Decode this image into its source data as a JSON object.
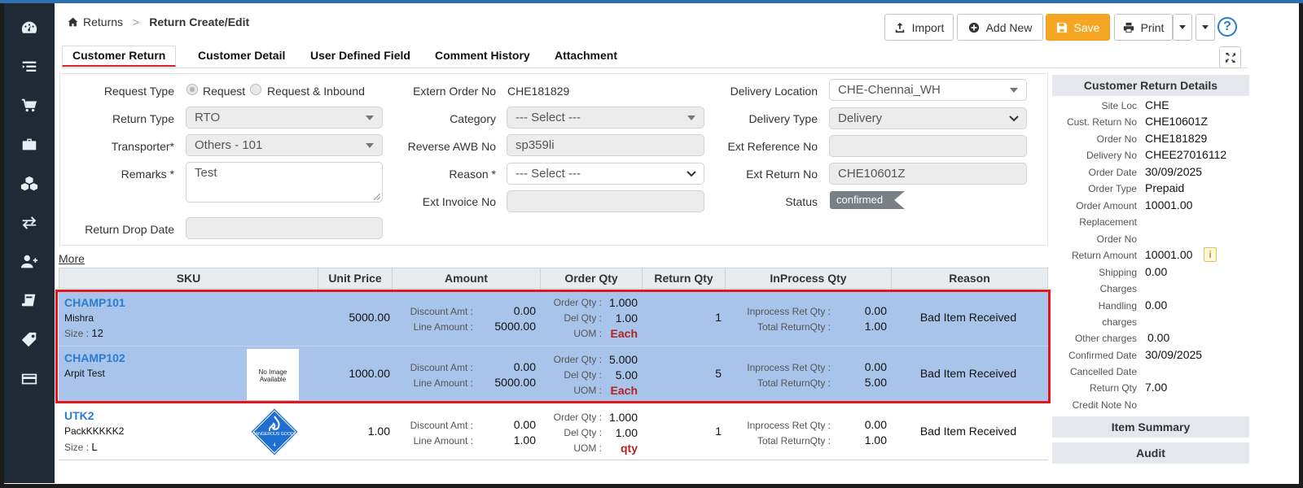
{
  "breadcrumb": {
    "root": "Returns",
    "current": "Return Create/Edit"
  },
  "toolbar": {
    "import": "Import",
    "add_new": "Add New",
    "save": "Save",
    "print": "Print"
  },
  "sidebar": {
    "icons": [
      "dashboard-icon",
      "list-icon",
      "cart-icon",
      "briefcase-icon",
      "cubes-icon",
      "exchange-icon",
      "add-user-icon",
      "book-icon",
      "tag-icon",
      "card-icon"
    ]
  },
  "tabs": [
    "Customer Return",
    "Customer Detail",
    "User Defined Field",
    "Comment History",
    "Attachment"
  ],
  "form": {
    "request_type_label": "Request Type",
    "request_option": "Request",
    "request_inbound_option": "Request & Inbound",
    "return_type_label": "Return Type",
    "return_type_value": "RTO",
    "transporter_label": "Transporter*",
    "transporter_value": "Others - 101",
    "remarks_label": "Remarks *",
    "remarks_value": "Test",
    "return_drop_date_label": "Return Drop Date",
    "extern_order_label": "Extern Order No",
    "extern_order_value": "CHE181829",
    "category_label": "Category",
    "category_value": "--- Select ---",
    "reverse_awb_label": "Reverse AWB No",
    "reverse_awb_value": "sp359li",
    "reason_label": "Reason *",
    "reason_value": "--- Select ---",
    "ext_invoice_label": "Ext Invoice No",
    "delivery_location_label": "Delivery Location",
    "delivery_location_value": "CHE-Chennai_WH",
    "delivery_type_label": "Delivery Type",
    "delivery_type_value": "Delivery",
    "ext_reference_label": "Ext Reference No",
    "ext_return_label": "Ext Return No",
    "ext_return_value": "CHE10601Z",
    "status_label": "Status",
    "status_value": "confirmed"
  },
  "more_link": "More",
  "grid": {
    "headers": [
      "SKU",
      "Unit Price",
      "Amount",
      "Order Qty",
      "Return Qty",
      "InProcess Qty",
      "Reason"
    ],
    "labels": {
      "discount": "Discount Amt :",
      "line_amount": "Line Amount :",
      "order_qty": "Order Qty :",
      "del_qty": "Del Qty :",
      "uom": "UOM :",
      "inprocess_ret": "Inprocess Ret Qty :",
      "total_return": "Total ReturnQty :",
      "size": "Size :"
    },
    "no_image_text": "No Image Available",
    "dangerous_text": "DANGEROUS GOODS",
    "rows": [
      {
        "sku": "CHAMP101",
        "desc": "Mishra",
        "size": "12",
        "unit_price": "5000.00",
        "discount": "0.00",
        "line_amount": "5000.00",
        "order_qty": "1.000",
        "del_qty": "1.00",
        "uom": "Each",
        "return_qty": "1",
        "inprocess": "0.00",
        "total_return": "1.00",
        "reason": "Bad Item Received"
      },
      {
        "sku": "CHAMP102",
        "desc": "Arpit Test",
        "size": "",
        "unit_price": "1000.00",
        "discount": "0.00",
        "line_amount": "5000.00",
        "order_qty": "5.000",
        "del_qty": "5.00",
        "uom": "Each",
        "return_qty": "5",
        "inprocess": "0.00",
        "total_return": "5.00",
        "reason": "Bad Item Received"
      },
      {
        "sku": "UTK2",
        "desc": "PackKKKKK2",
        "size": "L",
        "unit_price": "1.00",
        "discount": "0.00",
        "line_amount": "1.00",
        "order_qty": "1.000",
        "del_qty": "1.00",
        "uom": "qty",
        "return_qty": "1",
        "inprocess": "0.00",
        "total_return": "1.00",
        "reason": "Bad Item Received"
      }
    ]
  },
  "details": {
    "title": "Customer Return Details",
    "site_loc_k": "Site Loc",
    "site_loc_v": "CHE",
    "cust_return_k": "Cust. Return No",
    "cust_return_v": "CHE10601Z",
    "order_no_k": "Order No",
    "order_no_v": "CHE181829",
    "delivery_no_k": "Delivery No",
    "delivery_no_v": "CHEE27016112",
    "order_date_k": "Order Date",
    "order_date_v": "30/09/2025",
    "order_type_k": "Order Type",
    "order_type_v": "Prepaid",
    "order_amount_k": "Order Amount",
    "order_amount_v": "10001.00",
    "replacement_k1": "Replacement",
    "replacement_k2": "Order No",
    "return_amount_k": "Return Amount",
    "return_amount_v": "10001.00",
    "shipping_k1": "Shipping",
    "shipping_k2": "Charges",
    "shipping_v": "0.00",
    "handling_k1": "Handling",
    "handling_k2": "charges",
    "handling_v": "0.00",
    "other_k": "Other charges",
    "other_v": "0.00",
    "confirmed_k": "Confirmed Date",
    "confirmed_v": "30/09/2025",
    "cancelled_k": "Cancelled Date",
    "return_qty_k": "Return Qty",
    "return_qty_v": "7.00",
    "credit_note_k": "Credit Note No",
    "info": "i",
    "item_summary": "Item Summary",
    "audit": "Audit"
  }
}
